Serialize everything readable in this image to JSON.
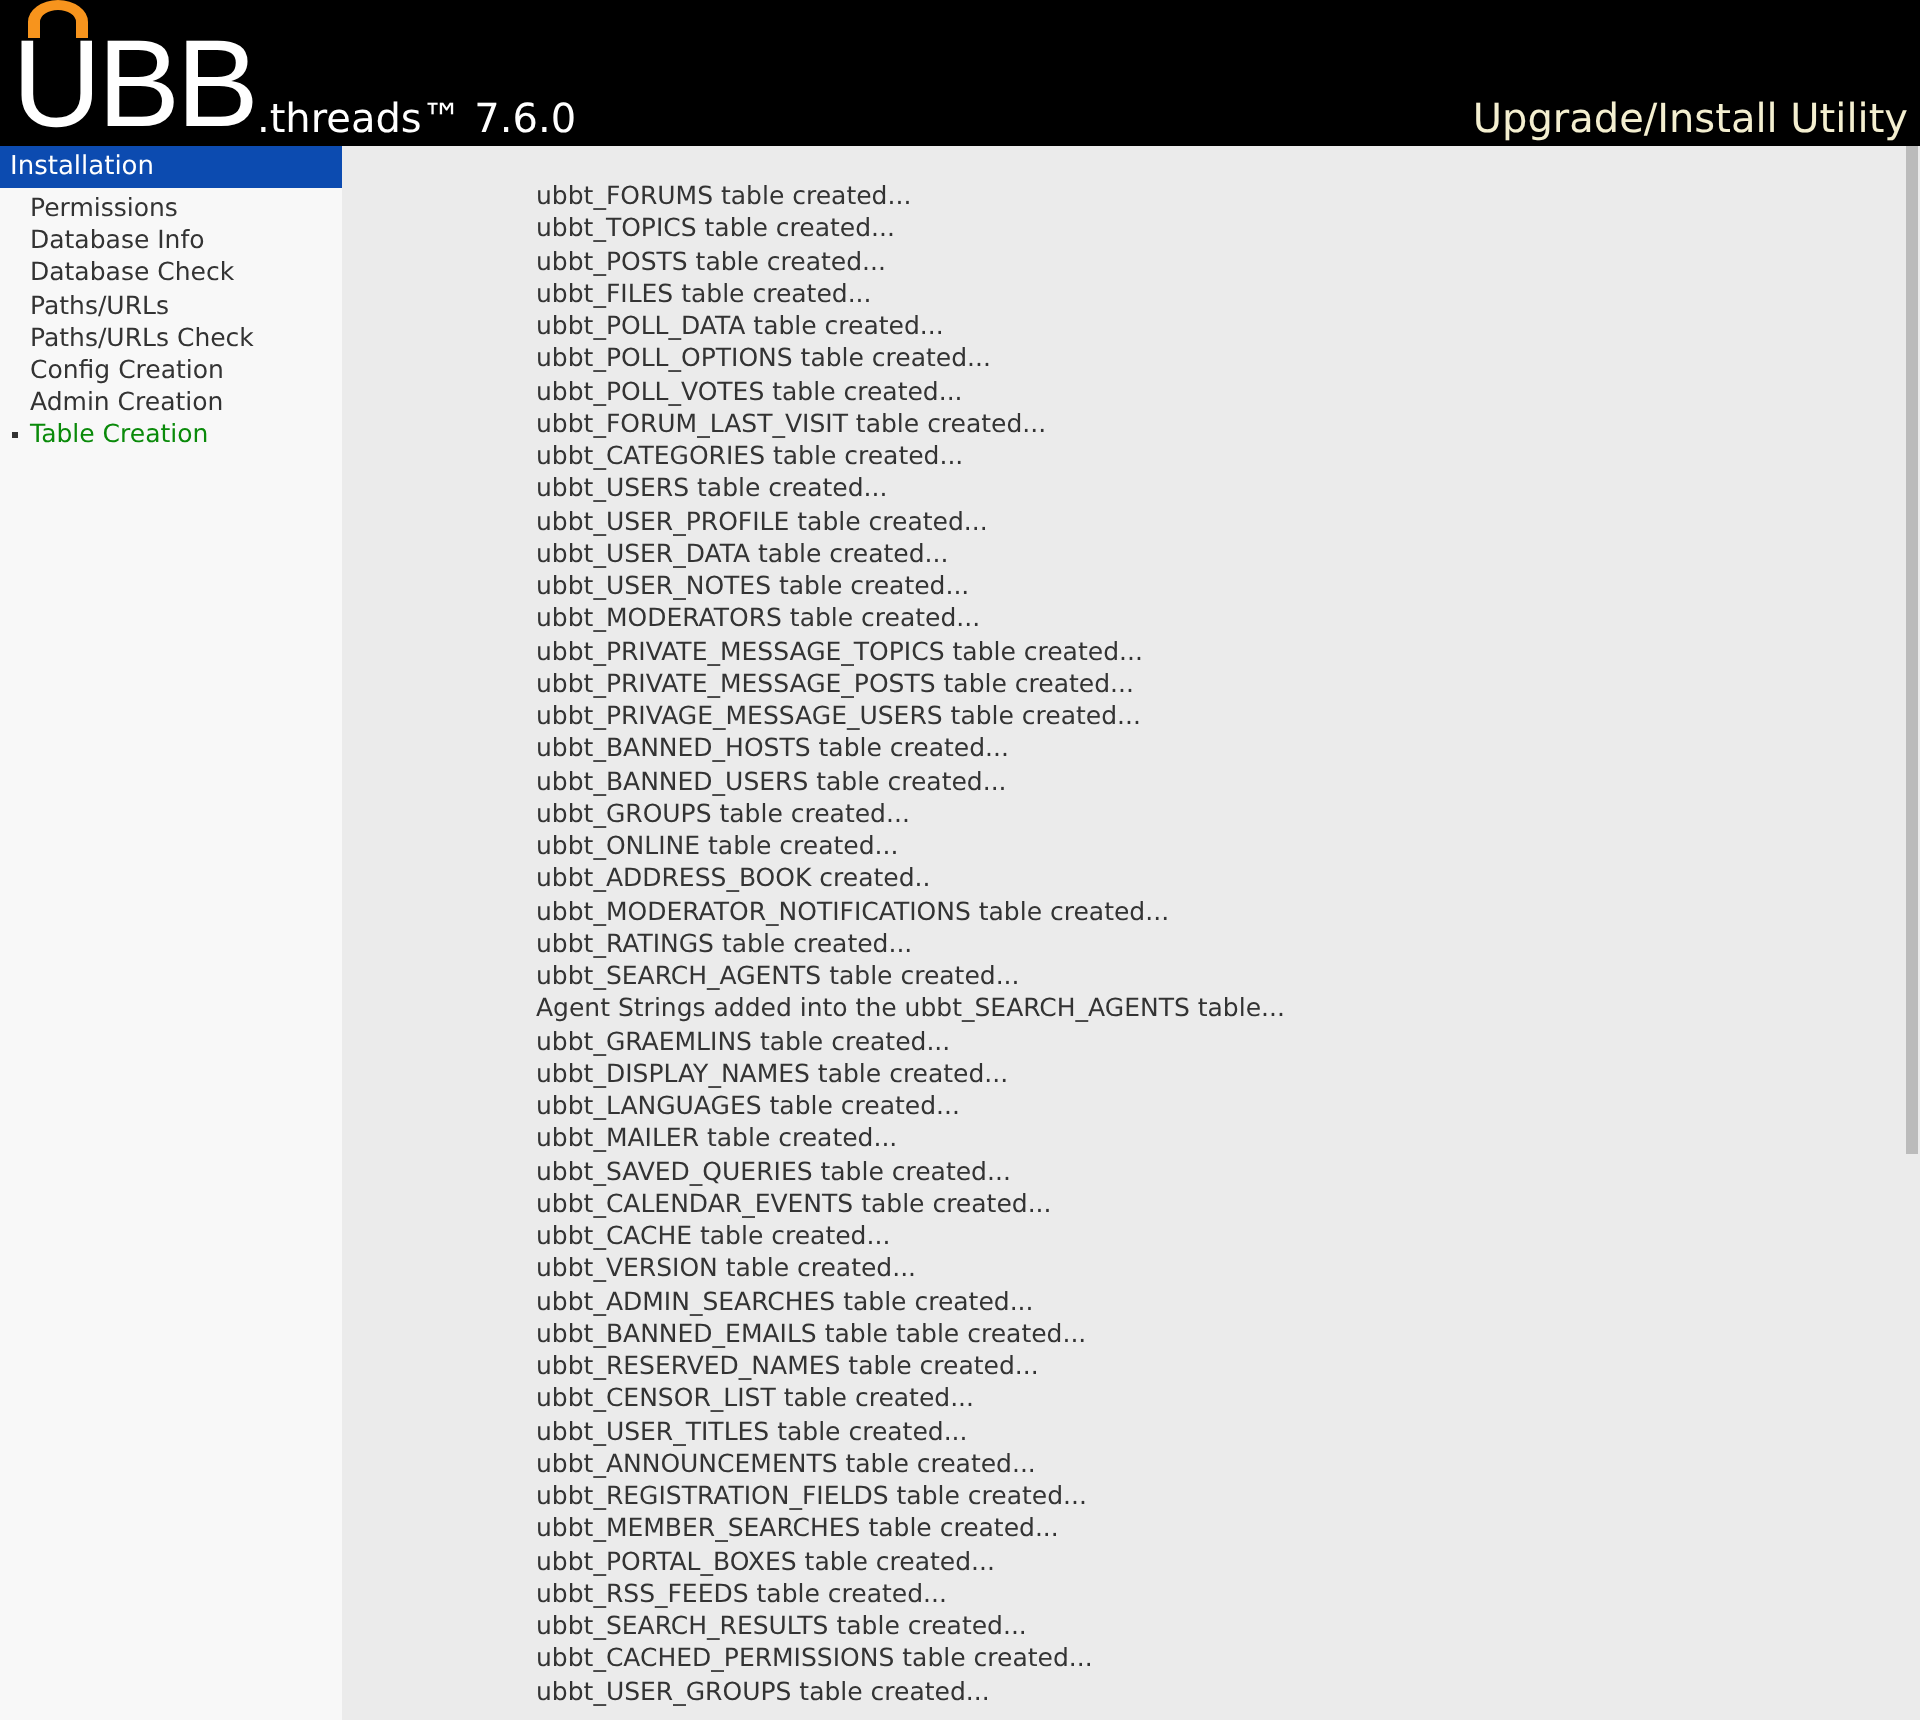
{
  "header": {
    "logo": "UBB",
    "product": ".threads™ 7.6.0",
    "utility": "Upgrade/Install Utility"
  },
  "sidebar": {
    "title": "Installation",
    "items": [
      {
        "label": "Permissions",
        "selected": false
      },
      {
        "label": "Database Info",
        "selected": false
      },
      {
        "label": "Database Check",
        "selected": false
      },
      {
        "label": "Paths/URLs",
        "selected": false
      },
      {
        "label": "Paths/URLs Check",
        "selected": false
      },
      {
        "label": "Config Creation",
        "selected": false
      },
      {
        "label": "Admin Creation",
        "selected": false
      },
      {
        "label": "Table Creation",
        "selected": true
      }
    ]
  },
  "log": [
    "ubbt_FORUMS table created...",
    "ubbt_TOPICS table created...",
    "ubbt_POSTS table created...",
    "ubbt_FILES table created...",
    "ubbt_POLL_DATA table created...",
    "ubbt_POLL_OPTIONS table created...",
    "ubbt_POLL_VOTES table created...",
    "ubbt_FORUM_LAST_VISIT table created...",
    "ubbt_CATEGORIES table created...",
    "ubbt_USERS table created...",
    "ubbt_USER_PROFILE table created...",
    "ubbt_USER_DATA table created...",
    "ubbt_USER_NOTES table created...",
    "ubbt_MODERATORS table created...",
    "ubbt_PRIVATE_MESSAGE_TOPICS table created...",
    "ubbt_PRIVATE_MESSAGE_POSTS table created...",
    "ubbt_PRIVAGE_MESSAGE_USERS table created...",
    "ubbt_BANNED_HOSTS table created...",
    "ubbt_BANNED_USERS table created...",
    "ubbt_GROUPS table created...",
    "ubbt_ONLINE table created...",
    "ubbt_ADDRESS_BOOK created..",
    "ubbt_MODERATOR_NOTIFICATIONS table created...",
    "ubbt_RATINGS table created...",
    "ubbt_SEARCH_AGENTS table created...",
    "Agent Strings added into the ubbt_SEARCH_AGENTS table...",
    "ubbt_GRAEMLINS table created...",
    "ubbt_DISPLAY_NAMES table created...",
    "ubbt_LANGUAGES table created...",
    "ubbt_MAILER table created...",
    "ubbt_SAVED_QUERIES table created...",
    "ubbt_CALENDAR_EVENTS table created...",
    "ubbt_CACHE table created...",
    "ubbt_VERSION table created...",
    "ubbt_ADMIN_SEARCHES table created...",
    "ubbt_BANNED_EMAILS table table created...",
    "ubbt_RESERVED_NAMES table created...",
    "ubbt_CENSOR_LIST table created...",
    "ubbt_USER_TITLES table created...",
    "ubbt_ANNOUNCEMENTS table created...",
    "ubbt_REGISTRATION_FIELDS table created...",
    "ubbt_MEMBER_SEARCHES table created...",
    "ubbt_PORTAL_BOXES table created...",
    "ubbt_RSS_FEEDS table created...",
    "ubbt_SEARCH_RESULTS table created...",
    "ubbt_CACHED_PERMISSIONS table created...",
    "ubbt_USER_GROUPS table created..."
  ]
}
